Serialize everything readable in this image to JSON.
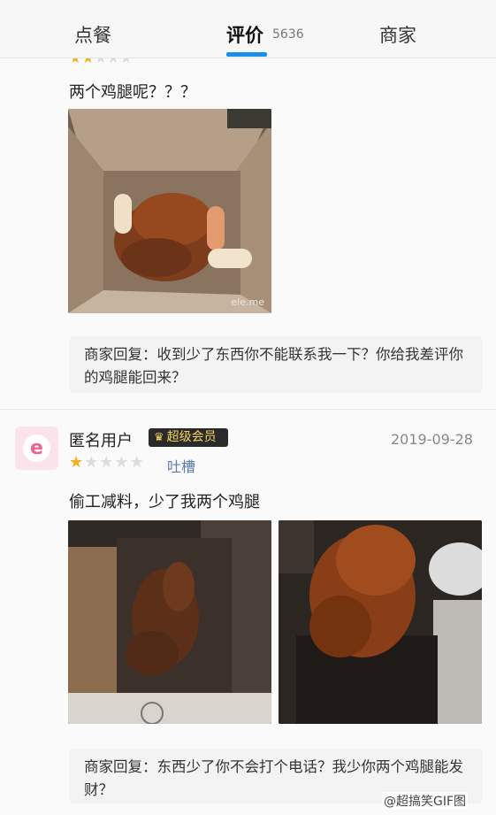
{
  "tabs": {
    "order": "点餐",
    "review": "评价",
    "review_count": "5636",
    "merchant": "商家"
  },
  "review1": {
    "comment": "两个鸡腿呢？？？",
    "photo_watermark": "ele.me",
    "merchant_reply": "商家回复：收到少了东西你不能联系我一下？你给我差评你的鸡腿能回来？"
  },
  "review2": {
    "avatar_glyph": "e",
    "username": "匿名用户",
    "badge": "超级会员",
    "badge_icon": "crown-icon",
    "date": "2019-09-28",
    "rating": 1,
    "rating_max": 5,
    "tag": "吐槽",
    "comment": "偷工减料，少了我两个鸡腿",
    "merchant_reply": "商家回复：东西少了你不会打个电话？我少你两个鸡腿能发财？"
  },
  "credit": "@超搞笑GIF图",
  "colors": {
    "accent": "#1a8ee8",
    "star": "#f2b01e",
    "tag": "#5b7cb2",
    "badge_text": "#f6d35f"
  }
}
